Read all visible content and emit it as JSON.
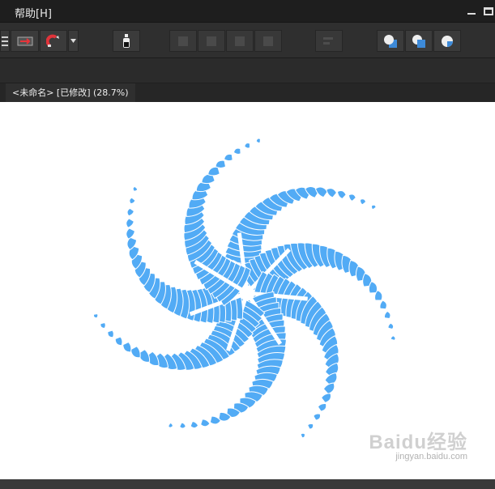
{
  "menubar": {
    "help_menu": "帮助[H]"
  },
  "toolbar": {
    "icons": [
      "align-icon",
      "arrow-panel-icon",
      "magnet-icon",
      "dropdown-icon",
      "bottle-icon",
      "arrange-icon",
      "arrange-icon",
      "arrange-icon",
      "arrange-icon",
      "distribute-icon",
      "shape-union-icon",
      "shape-subtract-icon",
      "shape-intersect-icon"
    ]
  },
  "document": {
    "tab_title": "<未命名> [已修改] (28.7%)"
  },
  "artwork": {
    "fill_color": "#52abf5",
    "arms": 7
  },
  "watermark": {
    "brand": "Baidu经验",
    "url": "jingyan.baidu.com"
  }
}
